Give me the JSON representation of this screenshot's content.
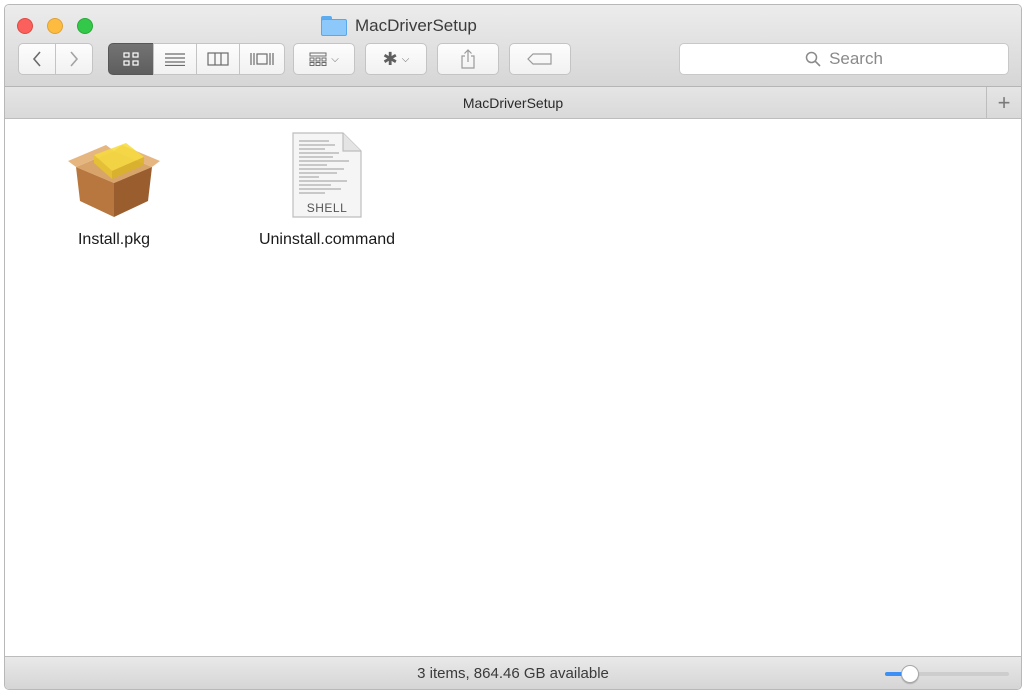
{
  "window": {
    "title": "MacDriverSetup"
  },
  "toolbar": {
    "back_icon": "chevron-left-icon",
    "forward_icon": "chevron-right-icon",
    "view_modes": [
      "icon-view",
      "list-view",
      "column-view",
      "cover-flow-view"
    ],
    "active_view": "icon-view",
    "arrange_icon": "arrange-grid-icon",
    "action_icon": "gear-icon",
    "share_icon": "share-icon",
    "tags_icon": "tag-icon"
  },
  "search": {
    "placeholder": "Search"
  },
  "pathbar": {
    "label": "MacDriverSetup",
    "add_tab": "+"
  },
  "files": [
    {
      "name": "Install.pkg",
      "icon": "package-icon"
    },
    {
      "name": "Uninstall.command",
      "icon": "shell-script-icon",
      "badge": "SHELL"
    }
  ],
  "status": {
    "text": "3 items, 864.46 GB available",
    "zoom_level": 0.2
  },
  "colors": {
    "close": "#fc605c",
    "minimize": "#fdbc40",
    "maximize": "#34c84a",
    "accent": "#3b8ff5"
  }
}
